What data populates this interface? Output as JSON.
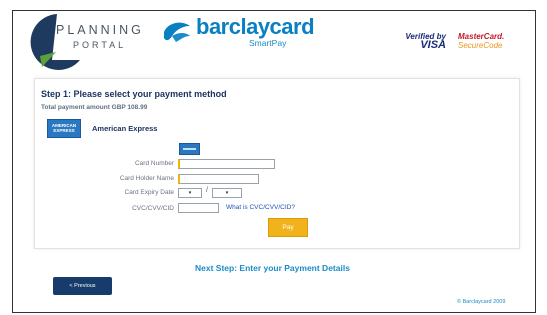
{
  "header": {
    "planning_portal_line1": "PLANNING",
    "planning_portal_line2": "PORTAL",
    "barclaycard_name": "barclaycard",
    "barclaycard_sub": "SmartPay",
    "verified_by": "Verified by",
    "visa": "VISA",
    "mastercard": "MasterCard.",
    "securecode": "SecureCode"
  },
  "payment": {
    "step_title": "Step 1: Please select your payment method",
    "total_amount": "Total payment amount GBP 108.99",
    "method_label": "American Express",
    "method_badge": "AMERICAN EXPRESS",
    "fields": {
      "card_number_label": "Card Number",
      "card_holder_label": "Card Holder Name",
      "expiry_label": "Card Expiry Date",
      "expiry_separator": "/",
      "expiry_month_value": "▾",
      "expiry_year_value": "▾",
      "cvc_label": "CVC/CVV/CID",
      "cvc_help_link": "What is CVC/CVV/CID?"
    },
    "pay_button": "Pay"
  },
  "footer": {
    "next_step": "Next Step: Enter your Payment Details",
    "previous_button": "< Previous",
    "copyright": "© Barclaycard 2009"
  },
  "colors": {
    "brand_navy": "#1d3560",
    "brand_blue": "#1c8bc9",
    "pay_orange": "#f2b21b",
    "planning_green": "#5aa13a",
    "planning_navy": "#1e3a5f"
  },
  "icons": {
    "planning_portal_logo": "planning-portal-logo-icon",
    "barclaycard_logo": "barclaycard-eagle-icon",
    "amex_card": "amex-card-icon"
  }
}
